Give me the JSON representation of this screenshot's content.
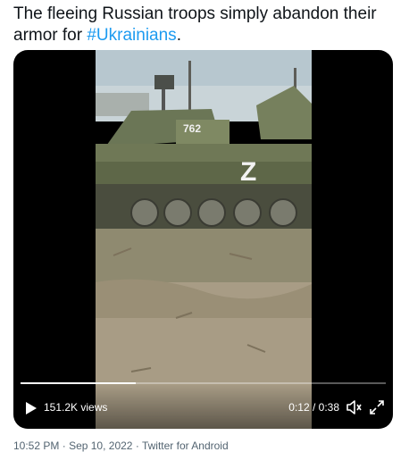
{
  "tweet": {
    "text_prefix": "The fleeing Russian troops simply abandon their armor for ",
    "hashtag": "#Ukrainians",
    "text_suffix": "."
  },
  "video": {
    "view_count": "151.2K views",
    "current_time": "0:12",
    "duration": "0:38",
    "time_separator": " / ",
    "progress": 0.316,
    "icons": [
      "play-icon",
      "volume-icon",
      "fullscreen-icon"
    ],
    "vehicle_marking": "Z",
    "vehicle_number": "762"
  },
  "meta": {
    "time": "10:52 PM",
    "date": "Sep 10, 2022",
    "separator": "·",
    "source": "Twitter for Android"
  },
  "colors": {
    "text": "#0f1419",
    "accent": "#1d9bf0",
    "muted": "#536471"
  }
}
